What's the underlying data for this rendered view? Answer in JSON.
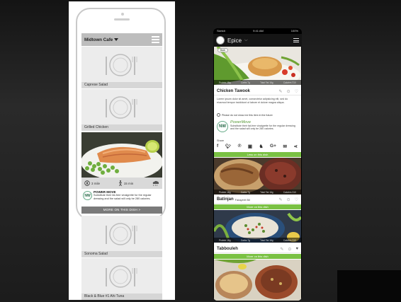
{
  "wireframe": {
    "location": "Midtown Cafe",
    "dishes": [
      "Caprese Salad",
      "Grilled Chicken"
    ],
    "dishes_below": [
      "Sonoma Salad",
      "Black & Blue #1 Ahi Tuna"
    ],
    "photo_stats": {
      "miles": "3 mile",
      "minutes": "15 min"
    },
    "power_move": {
      "logo": "NW",
      "title": "POWER MOVE",
      "text": "Substitute their fat-free vinaigrette for the regular dressing and the salad will only be 280 calories."
    },
    "more_button": "MORE ON THIS DISH >"
  },
  "app": {
    "status": {
      "carrier": "Sketch",
      "time": "9:41 AM",
      "battery": "100%"
    },
    "title": "Epice",
    "back": "Back",
    "stats": [
      "Protein 18g",
      "Carbs 7g",
      "Total Fat 16g",
      "Calories 310"
    ],
    "dish1": {
      "name": "Chicken Tawook",
      "description": "Lorem ipsum dolor sit amet, consectetur adipisicing elit, sed do eiusmod tempor incididunt ut labore et dolore magna aliqua.",
      "hide_option": "Please do not show me this item in the future",
      "power_move_title": "PowerMove",
      "power_move_text": "Substitute their fat-free vinaigrette for the regular dressing and the salad will only be 280 calories.",
      "share_label": "Share",
      "more_button": "Less on this dish"
    },
    "dish2": {
      "name": "Batinjan",
      "sub": "Fatayerit Bil",
      "more_button": "More on this dish"
    },
    "dish3": {
      "name": "Tabbouleh",
      "more_button": "More on this dish"
    },
    "colors": {
      "accent_green": "#7ac143",
      "app_bar": "#151515"
    }
  }
}
